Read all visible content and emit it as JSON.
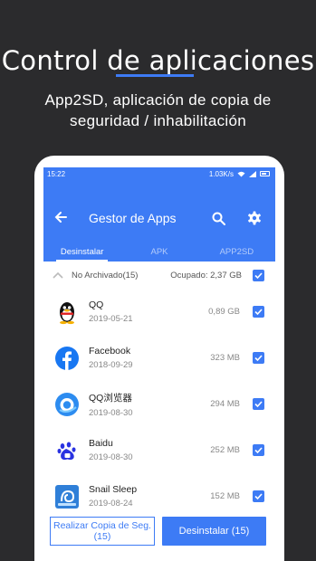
{
  "promo": {
    "title": "Control de aplicaciones",
    "subtitle_line1": "App2SD, aplicación de copia de",
    "subtitle_line2": "seguridad / inhabilitación"
  },
  "status_bar": {
    "time": "15:22",
    "speed": "1.03K/s"
  },
  "app_bar": {
    "back_icon": "arrow-left-icon",
    "title": "Gestor de Apps",
    "search_icon": "search-icon",
    "settings_icon": "gear-icon"
  },
  "tabs": [
    {
      "label": "Desinstalar",
      "active": true
    },
    {
      "label": "APK",
      "active": false
    },
    {
      "label": "APP2SD",
      "active": false
    }
  ],
  "group": {
    "label": "No Archivado(15)",
    "size": "Ocupado: 2,37 GB",
    "checked": true
  },
  "apps": [
    {
      "name": "QQ",
      "date": "2019-05-21",
      "size": "0,89 GB",
      "icon": "qq-penguin-icon",
      "checked": true
    },
    {
      "name": "Facebook",
      "date": "2018-09-29",
      "size": "323 MB",
      "icon": "facebook-icon",
      "checked": true
    },
    {
      "name": "QQ浏览器",
      "date": "2019-08-30",
      "size": "294 MB",
      "icon": "qq-browser-icon",
      "checked": true
    },
    {
      "name": "Baidu",
      "date": "2019-08-30",
      "size": "252 MB",
      "icon": "baidu-paw-icon",
      "checked": true
    },
    {
      "name": "Snail Sleep",
      "date": "2019-08-24",
      "size": "152 MB",
      "icon": "snail-sleep-icon",
      "checked": true
    }
  ],
  "buttons": {
    "backup_line1": "Realizar Copia de Seg.",
    "backup_line2": "(15)",
    "uninstall": "Desinstalar (15)"
  },
  "colors": {
    "accent": "#3d7bf5",
    "background": "#2b2b2d"
  }
}
